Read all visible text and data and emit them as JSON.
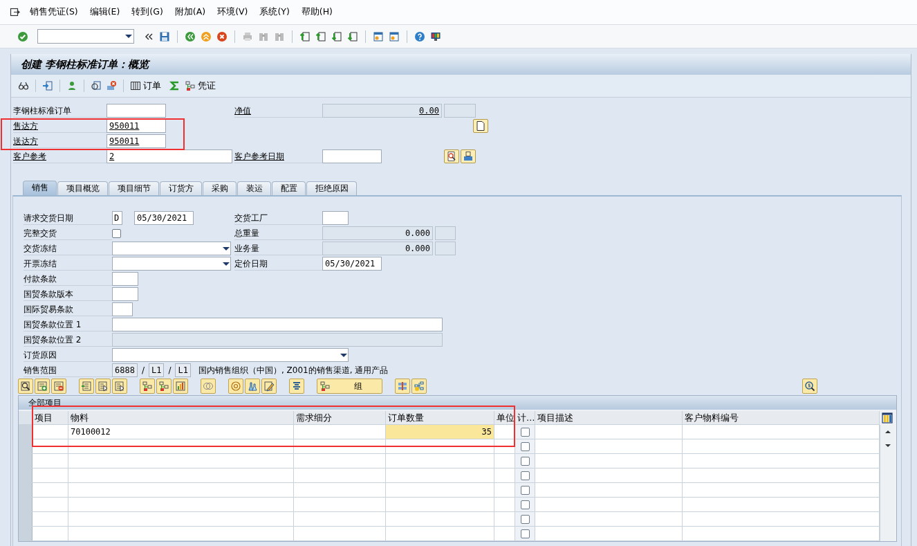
{
  "menu": [
    {
      "label": "销售凭证(S)"
    },
    {
      "label": "编辑(E)"
    },
    {
      "label": "转到(G)"
    },
    {
      "label": "附加(A)"
    },
    {
      "label": "环境(V)"
    },
    {
      "label": "系统(Y)"
    },
    {
      "label": "帮助(H)"
    }
  ],
  "window": {
    "title": "创建 李钢柱标准订单：概览"
  },
  "app_toolbar": {
    "order_button": "订单",
    "document_button": "凭证"
  },
  "header": {
    "highlighted": true,
    "order_type": {
      "label": "李钢柱标准订单"
    },
    "net_value": {
      "label": "净值",
      "value": "0.00"
    },
    "sold_to": {
      "label": "售达方",
      "value": "950011"
    },
    "ship_to": {
      "label": "送达方",
      "value": "950011"
    },
    "customer_reference": {
      "label": "客户参考",
      "value": "2"
    },
    "customer_reference_date": {
      "label": "客户参考日期"
    }
  },
  "tabs": [
    {
      "label": "销售",
      "selected": true
    },
    {
      "label": "项目概览",
      "selected": false
    },
    {
      "label": "项目细节",
      "selected": false
    },
    {
      "label": "订货方",
      "selected": false
    },
    {
      "label": "采购",
      "selected": false
    },
    {
      "label": "装运",
      "selected": false
    },
    {
      "label": "配置",
      "selected": false
    },
    {
      "label": "拒绝原因",
      "selected": false
    }
  ],
  "sales_rows": [
    {
      "kind": "date",
      "label": "请求交货日期",
      "code": "D",
      "value": "05/30/2021",
      "right": {
        "kind": "input",
        "label": "交货工厂"
      }
    },
    {
      "kind": "checkbox",
      "label": "完整交货",
      "checked": false,
      "right": {
        "kind": "readonly",
        "label": "总重量",
        "value": "0.000"
      }
    },
    {
      "kind": "dropdown",
      "label": "交货冻结",
      "right": {
        "kind": "readonly",
        "label": "业务量",
        "value": "0.000"
      }
    },
    {
      "kind": "dropdown",
      "label": "开票冻结",
      "right": {
        "kind": "input",
        "label": "定价日期",
        "value": "05/30/2021"
      }
    },
    {
      "kind": "input",
      "label": "付款条款",
      "disabled": false
    },
    {
      "kind": "input",
      "label": "国贸条款版本",
      "disabled": false
    },
    {
      "kind": "input",
      "label": "国际贸易条款",
      "disabled": false
    },
    {
      "kind": "input",
      "label": "国贸条款位置 1",
      "disabled": false
    },
    {
      "kind": "input",
      "label": "国贸条款位置 2",
      "disabled": true
    },
    {
      "kind": "dropdown",
      "label": "订货原因"
    },
    {
      "kind": "area",
      "label": "销售范围",
      "values": [
        "6888",
        "L1",
        "L1"
      ],
      "separators": [
        "/",
        "/"
      ],
      "description": "国内销售组织（中国）, Z001的销售渠道, 通用产品"
    }
  ],
  "table_toolbar": {
    "group_button": "组"
  },
  "table": {
    "title": "全部项目",
    "highlighted": true,
    "columns": [
      "项目",
      "物料",
      "需求细分",
      "订单数量",
      "单位",
      "计…",
      "项目描述",
      "客户物料编号"
    ],
    "rows": [
      {
        "material": "70100012",
        "quantity": "35",
        "focused": true,
        "checked": false
      },
      {
        "focused": false,
        "checked": false
      },
      {
        "focused": false,
        "checked": false
      },
      {
        "focused": false,
        "checked": false
      },
      {
        "focused": false,
        "checked": false
      },
      {
        "focused": false,
        "checked": false
      },
      {
        "focused": false,
        "checked": false
      },
      {
        "focused": false,
        "checked": false
      }
    ]
  }
}
